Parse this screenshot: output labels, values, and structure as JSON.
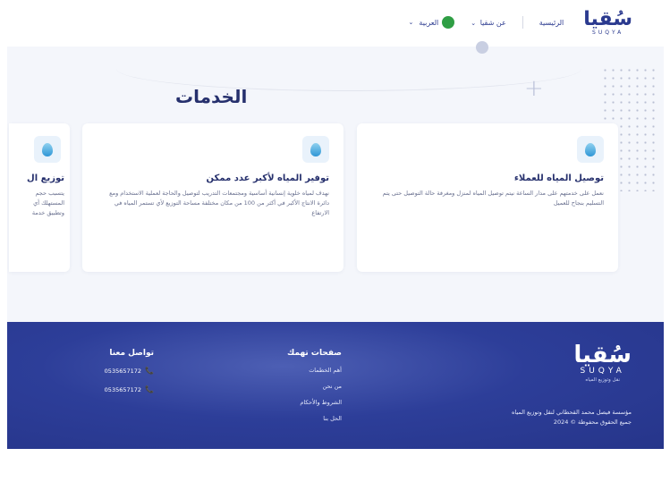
{
  "header": {
    "logo_ar": "سُقيا",
    "logo_en": "SUQYA",
    "nav": [
      "الرئيسية",
      "عن شقيا",
      "العربية"
    ]
  },
  "services": {
    "title": "الخدمات",
    "cards": [
      {
        "title": "توصيل المياه للعملاء",
        "desc": "نعمل على خدمتهم على مدار الساعة نيتم توصيل المياه لمنزل ومغرفة حالة التوصيل حتى يتم التسليم بنجاح للعميل"
      },
      {
        "title": "توفير المياه لأكبر عدد ممكن",
        "desc": "نهدف لمياه خلوية إنسانية أساسية ومجتمعات التدريب لتوصيل والحاجة لعملية الاستخدام ومع دائرة الانتاج الأكبر في أكثر من 100 من مكان مختلفة مساحة التوزيع لأي تستمر المياه في الارتفاع"
      },
      {
        "title": "توزيع ال",
        "desc": "يتسبب حجم المستهلك أي وتطبيق خدمة"
      }
    ]
  },
  "footer": {
    "logo_ar": "سُقيا",
    "logo_en": "SUQYA",
    "tagline": "نقل وتوزيع المياه",
    "about_line1": "مؤسسة فيصل محمد القحطاني لنقل وتوزيع المياه",
    "about_line2": "جميع الحقوق محفوظة © 2024",
    "links_title": "صفحات تهمك",
    "links": [
      "أهم الخطمات",
      "من نحن",
      "الشروط والأحكام",
      "الحل بنا"
    ],
    "contact_title": "تواصل معنا",
    "phones": [
      "0535657172",
      "0535657172"
    ]
  },
  "colors": {
    "primary": "#2d3e99",
    "title": "#26306d",
    "drop": "#2f96d6"
  }
}
